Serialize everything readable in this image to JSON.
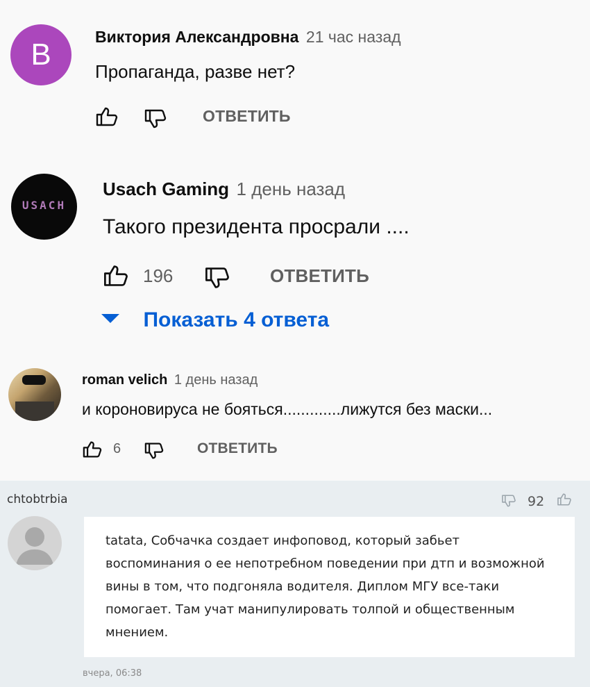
{
  "comments": [
    {
      "author": "Виктория Александровна",
      "time": "21 час назад",
      "text": "Пропаганда, разве нет?",
      "avatar_letter": "В",
      "avatar_color": "#ab47bc",
      "likes": "",
      "reply_label": "ОТВЕТИТЬ"
    },
    {
      "author": "Usach Gaming",
      "time": "1 день назад",
      "text": "Такого президента просрали ....",
      "avatar_text": "USACH",
      "likes": "196",
      "reply_label": "ОТВЕТИТЬ",
      "show_replies": "Показать 4 ответа",
      "accent_color": "#065fd4"
    },
    {
      "author": "roman velich",
      "time": "1 день назад",
      "text": "и короновируса не бояться.............лижутся без маски...",
      "likes": "6",
      "reply_label": "ОТВЕТИТЬ"
    }
  ],
  "forum_comment": {
    "author": "chtobtrbia",
    "score": "92",
    "text": "tatata, Собчачка создает инфоповод, который забьет воспоминания о ее непотребном поведении при дтп и возможной вины в том, что подгоняла водителя. Диплом МГУ все-таки помогает. Там учат манипулировать толпой и общественным мнением.",
    "time": "вчера, 06:38"
  },
  "icons": [
    "thumb-up-icon",
    "thumb-down-icon",
    "caret-down-icon",
    "user-placeholder-icon"
  ]
}
